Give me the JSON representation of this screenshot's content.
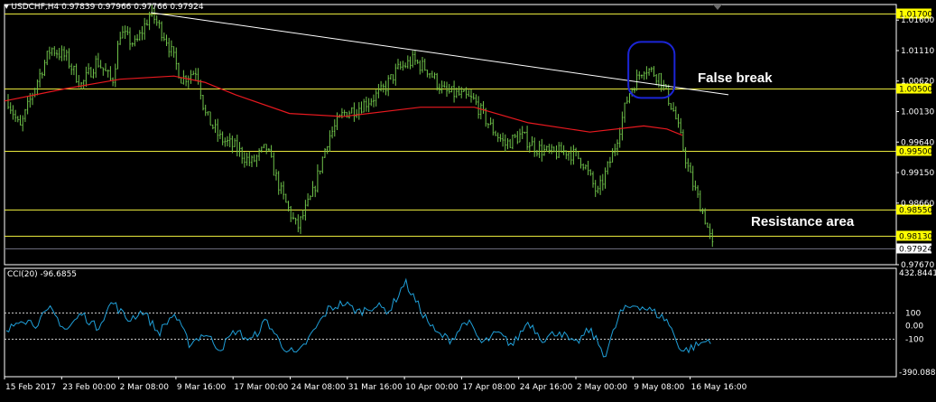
{
  "header": {
    "menu_icon": "triangle-down-icon",
    "symbol": "USDCHF,H4",
    "ohlc": "0.97839 0.97966 0.97766 0.97924"
  },
  "indicator": {
    "label": "CCI(20) -96.6855",
    "scale_top": "432.8441",
    "scale_bottom": "-390.0889",
    "levels": [
      "100",
      "0.00",
      "-100"
    ]
  },
  "annotations": {
    "false_break": "False break",
    "resistance_area": "Resistance area"
  },
  "price_scale": [
    "1.01600",
    "1.01110",
    "1.00620",
    "1.00130",
    "0.99640",
    "0.99150",
    "0.98660",
    "0.97670"
  ],
  "levels": [
    {
      "label": "1.01700",
      "value": 1.017
    },
    {
      "label": "1.00500",
      "value": 1.005
    },
    {
      "label": "0.99500",
      "value": 0.995
    },
    {
      "label": "0.98550",
      "value": 0.9855
    },
    {
      "label": "0.98130",
      "value": 0.9813
    }
  ],
  "current_price": "0.97924",
  "time_labels": [
    "15 Feb 2017",
    "23 Feb 00:00",
    "2 Mar 08:00",
    "9 Mar 16:00",
    "17 Mar 00:00",
    "24 Mar 08:00",
    "31 Mar 16:00",
    "10 Apr 00:00",
    "17 Apr 08:00",
    "24 Apr 16:00",
    "2 May 00:00",
    "9 May 08:00",
    "16 May 16:00"
  ],
  "colors": {
    "background": "#000000",
    "candles": "#6fc24a",
    "moving_average": "#e8191f",
    "trendline": "#ffffff",
    "level_line": "#e7e73c",
    "level_label_bg": "#ffff00",
    "cci_line": "#1f9fd8",
    "circle": "#1b25d6",
    "axis": "#ffffff"
  },
  "chart_data": {
    "type": "line",
    "price_knots": [
      [
        "15 Feb 2017",
        1.0045
      ],
      [
        "17 Feb 2017",
        0.9985
      ],
      [
        "19 Feb 2017",
        1.0055
      ],
      [
        "21 Feb 2017",
        1.0115
      ],
      [
        "23 Feb 2017",
        1.01
      ],
      [
        "25 Feb 2017",
        1.0055
      ],
      [
        "27 Feb 2017",
        1.0095
      ],
      [
        "1 Mar 2017",
        1.006
      ],
      [
        "2 Mar 2017",
        1.014
      ],
      [
        "4 Mar 2017",
        1.012
      ],
      [
        "6 Mar 2017",
        1.0172
      ],
      [
        "8 Mar 2017",
        1.013
      ],
      [
        "10 Mar 2017",
        1.0065
      ],
      [
        "12 Mar 2017",
        1.008
      ],
      [
        "13 Mar 2017",
        1.001
      ],
      [
        "15 Mar 2017",
        0.997
      ],
      [
        "17 Mar 2017",
        0.9955
      ],
      [
        "19 Mar 2017",
        0.993
      ],
      [
        "21 Mar 2017",
        0.9955
      ],
      [
        "23 Mar 2017",
        0.988
      ],
      [
        "25 Mar 2017",
        0.9825
      ],
      [
        "27 Mar 2017",
        0.988
      ],
      [
        "29 Mar 2017",
        0.997
      ],
      [
        "31 Mar 2017",
        1.001
      ],
      [
        "2 Apr 2017",
        1.002
      ],
      [
        "5 Apr 2017",
        1.0045
      ],
      [
        "7 Apr 2017",
        1.008
      ],
      [
        "9 Apr 2017",
        1.0095
      ],
      [
        "11 Apr 2017",
        1.008
      ],
      [
        "13 Apr 2017",
        1.0045
      ],
      [
        "15 Apr 2017",
        1.004
      ],
      [
        "17 Apr 2017",
        1.003
      ],
      [
        "19 Apr 2017",
        0.999
      ],
      [
        "21 Apr 2017",
        0.996
      ],
      [
        "23 Apr 2017",
        0.9975
      ],
      [
        "25 Apr 2017",
        0.9955
      ],
      [
        "27 Apr 2017",
        0.9945
      ],
      [
        "29 Apr 2017",
        0.995
      ],
      [
        "1 May 2017",
        0.9935
      ],
      [
        "3 May 2017",
        0.988
      ],
      [
        "5 May 2017",
        0.9945
      ],
      [
        "7 May 2017",
        1.004
      ],
      [
        "9 May 2017",
        1.0085
      ],
      [
        "11 May 2017",
        1.007
      ],
      [
        "13 May 2017",
        1.001
      ],
      [
        "15 May 2017",
        0.991
      ],
      [
        "17 May 2017",
        0.984
      ],
      [
        "18 May 2017",
        0.9792
      ]
    ],
    "ma_knots": [
      [
        "15 Feb 2017",
        1.003
      ],
      [
        "23 Feb 2017",
        1.005
      ],
      [
        "2 Mar 2017",
        1.0065
      ],
      [
        "9 Mar 2017",
        1.007
      ],
      [
        "13 Mar 2017",
        1.006
      ],
      [
        "17 Mar 2017",
        1.004
      ],
      [
        "24 Mar 2017",
        1.001
      ],
      [
        "31 Mar 2017",
        1.0005
      ],
      [
        "10 Apr 2017",
        1.002
      ],
      [
        "17 Apr 2017",
        1.002
      ],
      [
        "24 Apr 2017",
        0.9995
      ],
      [
        "2 May 2017",
        0.998
      ],
      [
        "9 May 2017",
        0.999
      ],
      [
        "12 May 2017",
        0.9985
      ],
      [
        "14 May 2017",
        0.9975
      ]
    ],
    "trendline": [
      [
        "6 Mar 2017",
        1.0172
      ],
      [
        "20 May 2017",
        1.004
      ]
    ],
    "cci_knots": [
      [
        "15 Feb 2017",
        -80
      ],
      [
        "17 Feb 2017",
        60
      ],
      [
        "19 Feb 2017",
        10
      ],
      [
        "21 Feb 2017",
        120
      ],
      [
        "23 Feb 2017",
        -40
      ],
      [
        "25 Feb 2017",
        90
      ],
      [
        "27 Feb 2017",
        -20
      ],
      [
        "1 Mar 2017",
        180
      ],
      [
        "3 Mar 2017",
        40
      ],
      [
        "5 Mar 2017",
        110
      ],
      [
        "7 Mar 2017",
        -60
      ],
      [
        "9 Mar 2017",
        90
      ],
      [
        "11 Mar 2017",
        -140
      ],
      [
        "13 Mar 2017",
        -60
      ],
      [
        "15 Mar 2017",
        -180
      ],
      [
        "17 Mar 2017",
        -40
      ],
      [
        "19 Mar 2017",
        -120
      ],
      [
        "21 Mar 2017",
        40
      ],
      [
        "23 Mar 2017",
        -150
      ],
      [
        "25 Mar 2017",
        -230
      ],
      [
        "27 Mar 2017",
        -60
      ],
      [
        "29 Mar 2017",
        120
      ],
      [
        "31 Mar 2017",
        170
      ],
      [
        "2 Apr 2017",
        100
      ],
      [
        "4 Apr 2017",
        150
      ],
      [
        "6 Apr 2017",
        110
      ],
      [
        "8 Apr 2017",
        330
      ],
      [
        "10 Apr 2017",
        120
      ],
      [
        "12 Apr 2017",
        -60
      ],
      [
        "14 Apr 2017",
        -110
      ],
      [
        "16 Apr 2017",
        40
      ],
      [
        "18 Apr 2017",
        -140
      ],
      [
        "20 Apr 2017",
        -60
      ],
      [
        "22 Apr 2017",
        -150
      ],
      [
        "24 Apr 2017",
        30
      ],
      [
        "26 Apr 2017",
        -110
      ],
      [
        "28 Apr 2017",
        -40
      ],
      [
        "30 Apr 2017",
        -150
      ],
      [
        "2 May 2017",
        -30
      ],
      [
        "4 May 2017",
        -230
      ],
      [
        "6 May 2017",
        100
      ],
      [
        "8 May 2017",
        160
      ],
      [
        "10 May 2017",
        110
      ],
      [
        "12 May 2017",
        40
      ],
      [
        "14 May 2017",
        -200
      ],
      [
        "16 May 2017",
        -150
      ],
      [
        "18 May 2017",
        -97
      ]
    ],
    "ylim": [
      0.9767,
      1.0185
    ],
    "cci_ylim": [
      -390.0889,
      432.8441
    ],
    "xlim": [
      "15 Feb 2017",
      "18 May 2017"
    ],
    "cci_levels": [
      100,
      0,
      -100
    ],
    "circle": {
      "from": "7 May 2017",
      "to": "13 May 2017",
      "low": 1.0035,
      "high": 1.0125
    }
  }
}
